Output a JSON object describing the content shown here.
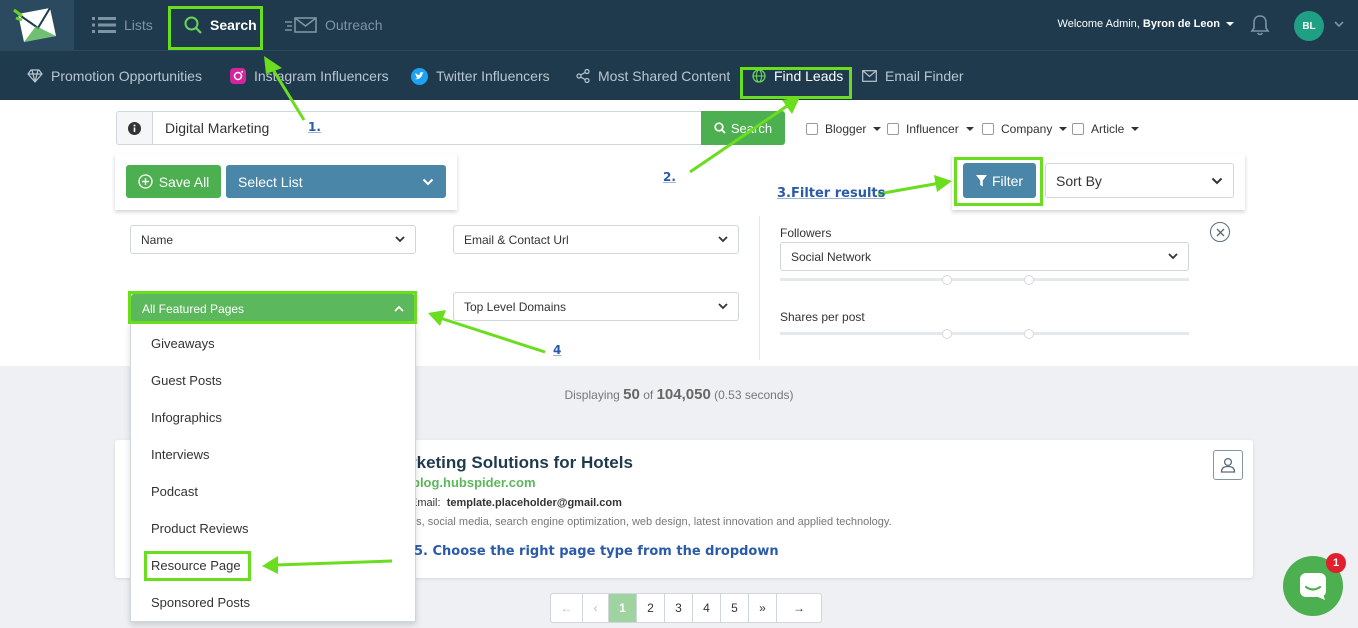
{
  "topnav": {
    "items": [
      {
        "label": "Lists",
        "icon": "list-icon"
      },
      {
        "label": "Search",
        "icon": "search-icon",
        "active": true
      },
      {
        "label": "Outreach",
        "icon": "outreach-icon"
      }
    ],
    "welcome_prefix": "Welcome Admin,",
    "welcome_name": "Byron de Leon",
    "avatar_initials": "BL"
  },
  "subnav": {
    "items": [
      {
        "label": "Promotion Opportunities",
        "icon": "diamond-icon"
      },
      {
        "label": "Instagram Influencers",
        "icon": "instagram-icon"
      },
      {
        "label": "Twitter Influencers",
        "icon": "twitter-icon"
      },
      {
        "label": "Most Shared Content",
        "icon": "share-icon"
      },
      {
        "label": "Find Leads",
        "icon": "globe-icon",
        "active": true
      },
      {
        "label": "Email Finder",
        "icon": "envelope-icon"
      }
    ]
  },
  "search": {
    "value": "Digital Marketing",
    "button_label": "Search",
    "filters": [
      "Blogger",
      "Influencer",
      "Company",
      "Article"
    ]
  },
  "actions": {
    "save_all": "Save All",
    "select_list": "Select List",
    "filter": "Filter",
    "sort_by": "Sort By"
  },
  "filters": {
    "name": "Name",
    "email_contact": "Email & Contact Url",
    "featured_pages": "All Featured Pages",
    "top_level_domains": "Top Level Domains",
    "followers_label": "Followers",
    "social_network": "Social Network",
    "shares_label": "Shares per post"
  },
  "results": {
    "prefix": "Displaying",
    "shown": "50",
    "of": "of",
    "total": "104,050",
    "time": "(0.53 seconds)"
  },
  "card": {
    "title": "rketing Solutions for Hotels",
    "url": "blog.hubspider.com",
    "email_label": "Email:",
    "email": "template.placeholder@gmail.com",
    "description": "ds, social media, search engine optimization, web design, latest innovation and applied technology."
  },
  "page_types": [
    "Giveaways",
    "Guest Posts",
    "Infographics",
    "Interviews",
    "Podcast",
    "Product Reviews",
    "Resource Page",
    "Sponsored Posts"
  ],
  "pagination": {
    "first": "←",
    "prev": "‹",
    "pages": [
      "1",
      "2",
      "3",
      "4",
      "5"
    ],
    "current": "1",
    "next": "»",
    "last": "→"
  },
  "chat": {
    "badge": "1"
  },
  "annotations": {
    "step1": "1.",
    "step2": "2.",
    "step3": "3.Filter results",
    "step4": "4",
    "step5": "5. Choose the right page type from the dropdown"
  },
  "colors": {
    "navbar": "#1f3a4d",
    "primary_green": "#4caf50",
    "primary_blue": "#4a86a8",
    "highlight_green": "#6bdd1f",
    "annotation_blue": "#2a5aa8"
  }
}
